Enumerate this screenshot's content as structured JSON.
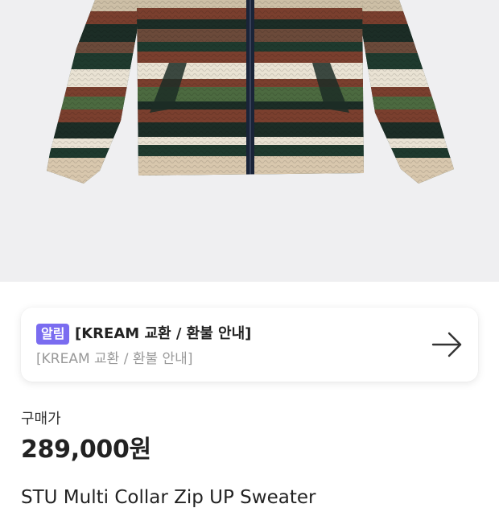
{
  "notice": {
    "badge": "알림",
    "title": "[KREAM 교환 / 환불 안내]",
    "subtitle": "[KREAM 교환 / 환불 안내]",
    "arrow_icon": "arrow-right-icon"
  },
  "price_section": {
    "label": "구매가",
    "price": "289,000원"
  },
  "product": {
    "name": "STU Multi Collar Zip UP Sweater"
  },
  "colors": {
    "badge": "#7a6cf0",
    "hero_background": "#efeff1"
  }
}
